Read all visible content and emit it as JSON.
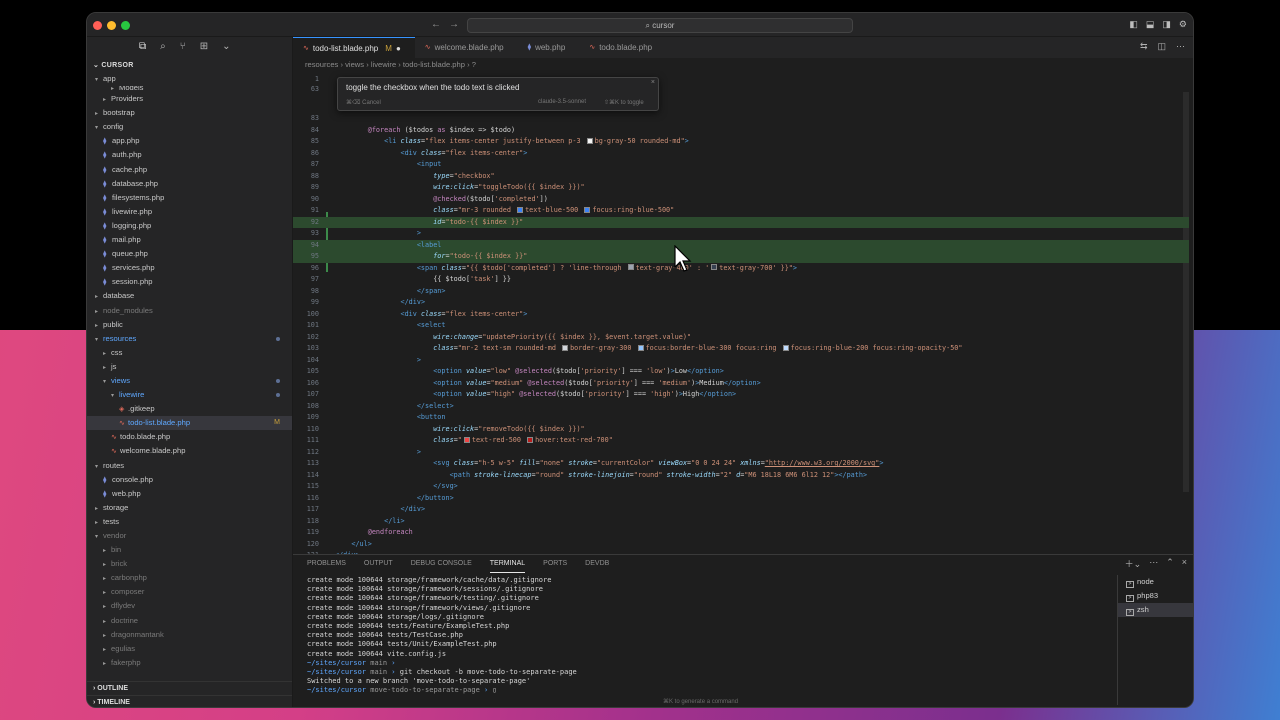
{
  "window": {
    "command_center": "cursor"
  },
  "sidebar": {
    "section": "CURSOR",
    "tree": [
      {
        "label": "app",
        "depth": 0,
        "type": "folder",
        "open": true
      },
      {
        "label": "Models",
        "depth": 2,
        "type": "folder",
        "cut": true
      },
      {
        "label": "Providers",
        "depth": 1,
        "type": "folder"
      },
      {
        "label": "bootstrap",
        "depth": 0,
        "type": "folder"
      },
      {
        "label": "config",
        "depth": 0,
        "type": "folder",
        "open": true
      },
      {
        "label": "app.php",
        "depth": 1,
        "type": "php"
      },
      {
        "label": "auth.php",
        "depth": 1,
        "type": "php"
      },
      {
        "label": "cache.php",
        "depth": 1,
        "type": "php"
      },
      {
        "label": "database.php",
        "depth": 1,
        "type": "php"
      },
      {
        "label": "filesystems.php",
        "depth": 1,
        "type": "php"
      },
      {
        "label": "livewire.php",
        "depth": 1,
        "type": "php"
      },
      {
        "label": "logging.php",
        "depth": 1,
        "type": "php"
      },
      {
        "label": "mail.php",
        "depth": 1,
        "type": "php"
      },
      {
        "label": "queue.php",
        "depth": 1,
        "type": "php"
      },
      {
        "label": "services.php",
        "depth": 1,
        "type": "php"
      },
      {
        "label": "session.php",
        "depth": 1,
        "type": "php"
      },
      {
        "label": "database",
        "depth": 0,
        "type": "folder"
      },
      {
        "label": "node_modules",
        "depth": 0,
        "type": "folder",
        "dim": true
      },
      {
        "label": "public",
        "depth": 0,
        "type": "folder"
      },
      {
        "label": "resources",
        "depth": 0,
        "type": "folder",
        "open": true,
        "mod": true,
        "dot": true
      },
      {
        "label": "css",
        "depth": 1,
        "type": "folder"
      },
      {
        "label": "js",
        "depth": 1,
        "type": "folder"
      },
      {
        "label": "views",
        "depth": 1,
        "type": "folder",
        "open": true,
        "mod": true,
        "dot": true
      },
      {
        "label": "livewire",
        "depth": 2,
        "type": "folder",
        "open": true,
        "mod": true,
        "dot": true
      },
      {
        "label": ".gitkeep",
        "depth": 3,
        "type": "git"
      },
      {
        "label": "todo-list.blade.php",
        "depth": 3,
        "type": "blade",
        "mod": true,
        "sel": true,
        "badge": "M"
      },
      {
        "label": "todo.blade.php",
        "depth": 2,
        "type": "blade"
      },
      {
        "label": "welcome.blade.php",
        "depth": 2,
        "type": "blade"
      },
      {
        "label": "routes",
        "depth": 0,
        "type": "folder",
        "open": true
      },
      {
        "label": "console.php",
        "depth": 1,
        "type": "php"
      },
      {
        "label": "web.php",
        "depth": 1,
        "type": "php"
      },
      {
        "label": "storage",
        "depth": 0,
        "type": "folder"
      },
      {
        "label": "tests",
        "depth": 0,
        "type": "folder"
      },
      {
        "label": "vendor",
        "depth": 0,
        "type": "folder",
        "open": true,
        "dim": true
      },
      {
        "label": "bin",
        "depth": 1,
        "type": "folder",
        "dim": true
      },
      {
        "label": "brick",
        "depth": 1,
        "type": "folder",
        "dim": true
      },
      {
        "label": "carbonphp",
        "depth": 1,
        "type": "folder",
        "dim": true
      },
      {
        "label": "composer",
        "depth": 1,
        "type": "folder",
        "dim": true
      },
      {
        "label": "dflydev",
        "depth": 1,
        "type": "folder",
        "dim": true
      },
      {
        "label": "doctrine",
        "depth": 1,
        "type": "folder",
        "dim": true
      },
      {
        "label": "dragonmantank",
        "depth": 1,
        "type": "folder",
        "dim": true
      },
      {
        "label": "egulias",
        "depth": 1,
        "type": "folder",
        "dim": true
      },
      {
        "label": "fakerphp",
        "depth": 1,
        "type": "folder",
        "dim": true
      }
    ],
    "outline": "OUTLINE",
    "timeline": "TIMELINE"
  },
  "tabs": [
    {
      "label": "todo-list.blade.php",
      "active": true,
      "modified": "M"
    },
    {
      "label": "welcome.blade.php"
    },
    {
      "label": "web.php"
    },
    {
      "label": "todo.blade.php"
    }
  ],
  "breadcrumb": [
    "resources",
    "views",
    "livewire",
    "todo-list.blade.php",
    "?"
  ],
  "inline_prompt": {
    "text": "toggle the checkbox when the todo text is clicked",
    "cancel": "⌘⌫ Cancel",
    "model": "claude-3.5-sonnet",
    "toggle": "⇧⌘K to toggle"
  },
  "code": {
    "top_lines": [
      {
        "n": "1",
        "h": ""
      },
      {
        "n": "63",
        "h": ""
      }
    ],
    "lines": [
      {
        "n": "83",
        "h": ""
      },
      {
        "n": "84",
        "h": "        <span class='dr'>@foreach</span> ($todos <span class='kw'>as</span> $index => $todo)"
      },
      {
        "n": "85",
        "h": "            <span class='tg'>&lt;li</span> <span class='at'>class</span>=<span class='st'>\"flex items-center justify-between p-3 <span class='sw' style='background:#f5f5f5'></span>bg-gray-50 rounded-md\"</span><span class='tg'>&gt;</span>"
      },
      {
        "n": "86",
        "h": "                <span class='tg'>&lt;div</span> <span class='at'>class</span>=<span class='st'>\"flex items-center\"</span><span class='tg'>&gt;</span>"
      },
      {
        "n": "87",
        "h": "                    <span class='tg'>&lt;input</span>"
      },
      {
        "n": "88",
        "h": "                        <span class='at'>type</span>=<span class='st'>\"checkbox\"</span>"
      },
      {
        "n": "89",
        "h": "                        <span class='at'>wire:click</span>=<span class='st'>\"toggleTodo({{ $index }})\"</span>"
      },
      {
        "n": "90",
        "h": "                        <span class='dr'>@checked</span>($todo[<span class='st'>'completed'</span>])"
      },
      {
        "n": "91",
        "h": "                        <span class='at'>class</span>=<span class='st'>\"mr-3 rounded <span class='sw' style='background:#3b82f6'></span>text-blue-500 <span class='sw' style='background:#3b82f6'></span>focus:ring-blue-500\"</span>"
      },
      {
        "n": "92",
        "h": "                        <span class='at'>id</span>=<span class='st'>\"todo-{{ $index }}\"</span>",
        "hl": true
      },
      {
        "n": "93",
        "h": "                    <span class='tg'>&gt;</span>"
      },
      {
        "n": "94",
        "h": "                    <span class='tg'>&lt;label</span>",
        "hl": true
      },
      {
        "n": "95",
        "h": "                        <span class='at'>for</span>=<span class='st'>\"todo-{{ $index }}\"</span>",
        "hl": true
      },
      {
        "n": "96",
        "h": "                    <span class='tg'>&lt;span</span> <span class='at'>class</span>=<span class='st'>\"{{ $todo['completed'] ? 'line-through <span class='sw' style='background:#9ca3af'></span>text-gray-400' : '<span class='sw' style='background:#374151'></span>text-gray-700' }}\"</span><span class='tg'>&gt;</span>"
      },
      {
        "n": "97",
        "h": "                        {{ $todo[<span class='st'>'task'</span>] }}"
      },
      {
        "n": "98",
        "h": "                    <span class='tg'>&lt;/span&gt;</span>"
      },
      {
        "n": "99",
        "h": "                <span class='tg'>&lt;/div&gt;</span>"
      },
      {
        "n": "100",
        "h": "                <span class='tg'>&lt;div</span> <span class='at'>class</span>=<span class='st'>\"flex items-center\"</span><span class='tg'>&gt;</span>"
      },
      {
        "n": "101",
        "h": "                    <span class='tg'>&lt;select</span>"
      },
      {
        "n": "102",
        "h": "                        <span class='at'>wire:change</span>=<span class='st'>\"updatePriority({{ $index }}, $event.target.value)\"</span>"
      },
      {
        "n": "103",
        "h": "                        <span class='at'>class</span>=<span class='st'>\"mr-2 text-sm rounded-md <span class='sw' style='background:#d1d5db'></span>border-gray-300 <span class='sw' style='background:#93c5fd'></span>focus:border-blue-300 focus:ring <span class='sw' style='background:#bfdbfe'></span>focus:ring-blue-200 focus:ring-opacity-50\"</span>"
      },
      {
        "n": "104",
        "h": "                    <span class='tg'>&gt;</span>"
      },
      {
        "n": "105",
        "h": "                        <span class='tg'>&lt;option</span> <span class='at'>value</span>=<span class='st'>\"low\"</span> <span class='dr'>@selected</span>($todo[<span class='st'>'priority'</span>] === <span class='st'>'low'</span>)<span class='tg'>&gt;</span>Low<span class='tg'>&lt;/option&gt;</span>"
      },
      {
        "n": "106",
        "h": "                        <span class='tg'>&lt;option</span> <span class='at'>value</span>=<span class='st'>\"medium\"</span> <span class='dr'>@selected</span>($todo[<span class='st'>'priority'</span>] === <span class='st'>'medium'</span>)<span class='tg'>&gt;</span>Medium<span class='tg'>&lt;/option&gt;</span>"
      },
      {
        "n": "107",
        "h": "                        <span class='tg'>&lt;option</span> <span class='at'>value</span>=<span class='st'>\"high\"</span> <span class='dr'>@selected</span>($todo[<span class='st'>'priority'</span>] === <span class='st'>'high'</span>)<span class='tg'>&gt;</span>High<span class='tg'>&lt;/option&gt;</span>"
      },
      {
        "n": "108",
        "h": "                    <span class='tg'>&lt;/select&gt;</span>"
      },
      {
        "n": "109",
        "h": "                    <span class='tg'>&lt;button</span>"
      },
      {
        "n": "110",
        "h": "                        <span class='at'>wire:click</span>=<span class='st'>\"removeTodo({{ $index }})\"</span>"
      },
      {
        "n": "111",
        "h": "                        <span class='at'>class</span>=<span class='st'>\"<span class='sw' style='background:#ef4444'></span>text-red-500 <span class='sw' style='background:#b91c1c'></span>hover:text-red-700\"</span>"
      },
      {
        "n": "112",
        "h": "                    <span class='tg'>&gt;</span>"
      },
      {
        "n": "113",
        "h": "                        <span class='tg'>&lt;svg</span> <span class='at'>class</span>=<span class='st'>\"h-5 w-5\"</span> <span class='at'>fill</span>=<span class='st'>\"none\"</span> <span class='at'>stroke</span>=<span class='st'>\"currentColor\"</span> <span class='at'>viewBox</span>=<span class='st'>\"0 0 24 24\"</span> <span class='at'>xmlns</span>=<span class='url'>\"http://www.w3.org/2000/svg\"</span><span class='tg'>&gt;</span>"
      },
      {
        "n": "114",
        "h": "                            <span class='tg'>&lt;path</span> <span class='at'>stroke-linecap</span>=<span class='st'>\"round\"</span> <span class='at'>stroke-linejoin</span>=<span class='st'>\"round\"</span> <span class='at'>stroke-width</span>=<span class='st'>\"2\"</span> <span class='at'>d</span>=<span class='st'>\"M6 18L18 6M6 6l12 12\"</span><span class='tg'>&gt;&lt;/path&gt;</span>"
      },
      {
        "n": "115",
        "h": "                        <span class='tg'>&lt;/svg&gt;</span>"
      },
      {
        "n": "116",
        "h": "                    <span class='tg'>&lt;/button&gt;</span>"
      },
      {
        "n": "117",
        "h": "                <span class='tg'>&lt;/div&gt;</span>"
      },
      {
        "n": "118",
        "h": "            <span class='tg'>&lt;/li&gt;</span>"
      },
      {
        "n": "119",
        "h": "        <span class='dr'>@endforeach</span>"
      },
      {
        "n": "120",
        "h": "    <span class='tg'>&lt;/ul&gt;</span>"
      },
      {
        "n": "121",
        "h": "<span class='tg'>&lt;/div&gt;</span>"
      }
    ]
  },
  "panel": {
    "tabs": [
      "PROBLEMS",
      "OUTPUT",
      "DEBUG CONSOLE",
      "TERMINAL",
      "PORTS",
      "DEVDB"
    ],
    "active_tab": "TERMINAL",
    "terminal_lines": [
      {
        "t": "create mode 100644 storage/framework/cache/data/.gitignore"
      },
      {
        "t": "create mode 100644 storage/framework/sessions/.gitignore"
      },
      {
        "t": "create mode 100644 storage/framework/testing/.gitignore"
      },
      {
        "t": "create mode 100644 storage/framework/views/.gitignore"
      },
      {
        "t": "create mode 100644 storage/logs/.gitignore"
      },
      {
        "t": "create mode 100644 tests/Feature/ExampleTest.php"
      },
      {
        "t": "create mode 100644 tests/TestCase.php"
      },
      {
        "t": "create mode 100644 tests/Unit/ExampleTest.php"
      },
      {
        "t": "create mode 100644 vite.config.js"
      },
      {
        "p": "~/sites/cursor",
        "b": "main",
        "c": ""
      },
      {
        "p": "~/sites/cursor",
        "b": "main",
        "c": "git checkout -b move-todo-to-separate-page"
      },
      {
        "t": "Switched to a new branch 'move-todo-to-separate-page'"
      },
      {
        "p": "~/sites/cursor",
        "b": "move-todo-to-separate-page",
        "c": "▯"
      }
    ],
    "hint": "⌘K to generate a command",
    "terminals": [
      "node",
      "php83",
      "zsh"
    ],
    "active_terminal": "zsh"
  }
}
